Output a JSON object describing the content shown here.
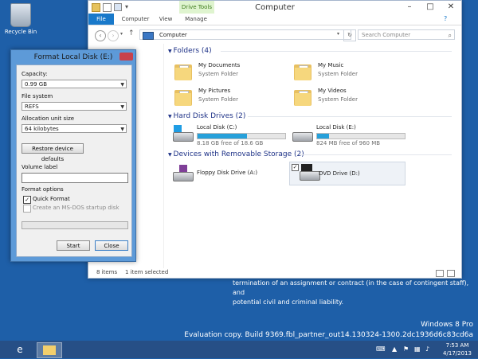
{
  "desktop": {
    "recycle_bin_label": "Recycle Bin",
    "notice_lines": [
      "termination of an assignment or contract (in the case of contingent staff), and",
      "potential civil and criminal liability."
    ],
    "watermark_line1": "Windows 8 Pro",
    "watermark_line2": "Evaluation copy. Build 9369.fbl_partner_out14.130324-1300.2dc1936d6c83cd6a"
  },
  "explorer": {
    "title": "Computer",
    "tabs": {
      "file": "File",
      "computer": "Computer",
      "view": "View",
      "manage": "Manage",
      "drive_tools": "Drive Tools"
    },
    "address": "Computer",
    "search_placeholder": "Search Computer",
    "groups": {
      "folders": "Folders (4)",
      "hdd": "Hard Disk Drives (2)",
      "removable": "Devices with Removable Storage (2)"
    },
    "folders": [
      {
        "name": "My Documents",
        "sub": "System Folder"
      },
      {
        "name": "My Music",
        "sub": "System Folder"
      },
      {
        "name": "My Pictures",
        "sub": "System Folder"
      },
      {
        "name": "My Videos",
        "sub": "System Folder"
      }
    ],
    "drives": [
      {
        "name": "Local Disk (C:)",
        "free": "8.18 GB free of 18.6 GB",
        "used_fraction": 0.56
      },
      {
        "name": "Local Disk (E:)",
        "free": "824 MB free of 960 MB",
        "used_fraction": 0.14
      }
    ],
    "removable": [
      {
        "name": "Floppy Disk Drive (A:)"
      },
      {
        "name": "DVD Drive (D:)"
      }
    ],
    "status_items": "8 items",
    "status_selected": "1 item selected"
  },
  "format_dialog": {
    "title": "Format Local Disk (E:)",
    "capacity_label": "Capacity:",
    "capacity_value": "0.99 GB",
    "filesystem_label": "File system",
    "filesystem_value": "REFS",
    "alloc_label": "Allocation unit size",
    "alloc_value": "64 kilobytes",
    "restore_button": "Restore device defaults",
    "volume_label": "Volume label",
    "format_options_label": "Format options",
    "quick_format_label": "Quick Format",
    "quick_format_checked": true,
    "msdos_label": "Create an MS-DOS startup disk",
    "start_button": "Start",
    "close_button": "Close"
  },
  "taskbar": {
    "time": "7:53 AM",
    "date": "4/17/2013"
  },
  "colors": {
    "accent": "#1979ca",
    "desktop": "#1e5fa8",
    "bar_fill": "#26a0da"
  }
}
